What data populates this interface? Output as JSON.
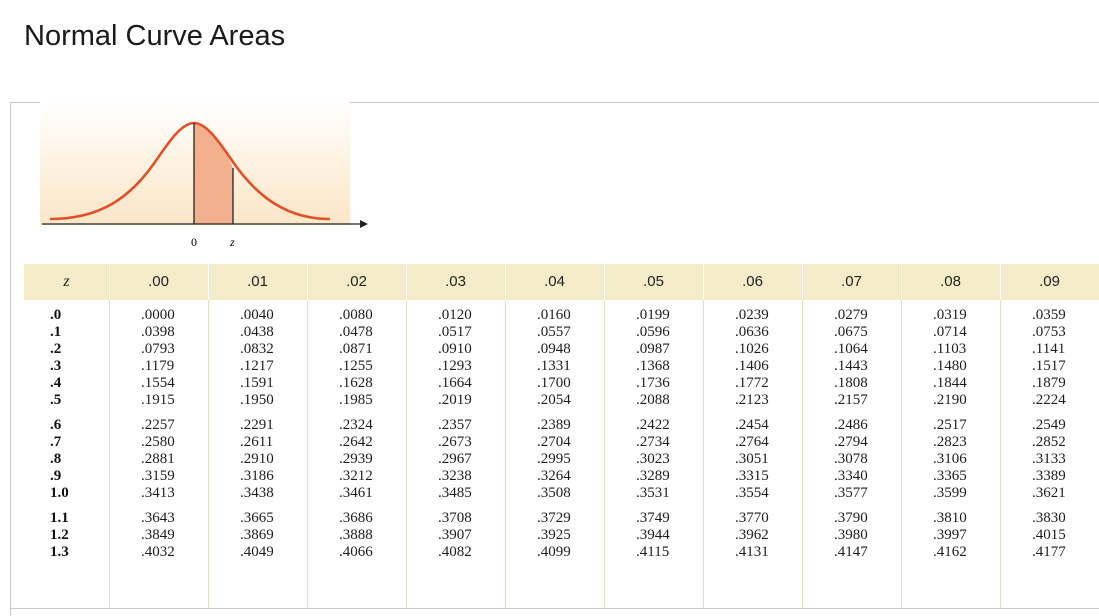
{
  "page_title": "Normal Curve Areas",
  "diagram": {
    "label_zero": "0",
    "label_z": "z",
    "colors": {
      "curve": "#e0502a",
      "shade": "#f2b08f",
      "panel": "#fbe6c8"
    }
  },
  "table": {
    "headers": [
      "z",
      ".00",
      ".01",
      ".02",
      ".03",
      ".04",
      ".05",
      ".06",
      ".07",
      ".08",
      ".09"
    ],
    "groups": [
      {
        "z": [
          ".0",
          ".1",
          ".2",
          ".3",
          ".4",
          ".5"
        ],
        "cols": [
          [
            ".0000",
            ".0398",
            ".0793",
            ".1179",
            ".1554",
            ".1915"
          ],
          [
            ".0040",
            ".0438",
            ".0832",
            ".1217",
            ".1591",
            ".1950"
          ],
          [
            ".0080",
            ".0478",
            ".0871",
            ".1255",
            ".1628",
            ".1985"
          ],
          [
            ".0120",
            ".0517",
            ".0910",
            ".1293",
            ".1664",
            ".2019"
          ],
          [
            ".0160",
            ".0557",
            ".0948",
            ".1331",
            ".1700",
            ".2054"
          ],
          [
            ".0199",
            ".0596",
            ".0987",
            ".1368",
            ".1736",
            ".2088"
          ],
          [
            ".0239",
            ".0636",
            ".1026",
            ".1406",
            ".1772",
            ".2123"
          ],
          [
            ".0279",
            ".0675",
            ".1064",
            ".1443",
            ".1808",
            ".2157"
          ],
          [
            ".0319",
            ".0714",
            ".1103",
            ".1480",
            ".1844",
            ".2190"
          ],
          [
            ".0359",
            ".0753",
            ".1141",
            ".1517",
            ".1879",
            ".2224"
          ]
        ]
      },
      {
        "z": [
          ".6",
          ".7",
          ".8",
          ".9",
          "1.0"
        ],
        "cols": [
          [
            ".2257",
            ".2580",
            ".2881",
            ".3159",
            ".3413"
          ],
          [
            ".2291",
            ".2611",
            ".2910",
            ".3186",
            ".3438"
          ],
          [
            ".2324",
            ".2642",
            ".2939",
            ".3212",
            ".3461"
          ],
          [
            ".2357",
            ".2673",
            ".2967",
            ".3238",
            ".3485"
          ],
          [
            ".2389",
            ".2704",
            ".2995",
            ".3264",
            ".3508"
          ],
          [
            ".2422",
            ".2734",
            ".3023",
            ".3289",
            ".3531"
          ],
          [
            ".2454",
            ".2764",
            ".3051",
            ".3315",
            ".3554"
          ],
          [
            ".2486",
            ".2794",
            ".3078",
            ".3340",
            ".3577"
          ],
          [
            ".2517",
            ".2823",
            ".3106",
            ".3365",
            ".3599"
          ],
          [
            ".2549",
            ".2852",
            ".3133",
            ".3389",
            ".3621"
          ]
        ]
      },
      {
        "z": [
          "1.1",
          "1.2",
          "1.3"
        ],
        "cols": [
          [
            ".3643",
            ".3849",
            ".4032"
          ],
          [
            ".3665",
            ".3869",
            ".4049"
          ],
          [
            ".3686",
            ".3888",
            ".4066"
          ],
          [
            ".3708",
            ".3907",
            ".4082"
          ],
          [
            ".3729",
            ".3925",
            ".4099"
          ],
          [
            ".3749",
            ".3944",
            ".4115"
          ],
          [
            ".3770",
            ".3962",
            ".4131"
          ],
          [
            ".3790",
            ".3980",
            ".4147"
          ],
          [
            ".3810",
            ".3997",
            ".4162"
          ],
          [
            ".3830",
            ".4015",
            ".4177"
          ]
        ]
      }
    ]
  }
}
